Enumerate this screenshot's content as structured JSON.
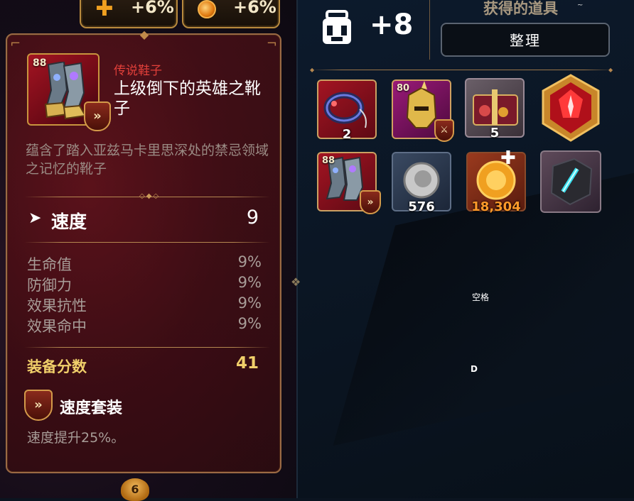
{
  "top_stats": [
    {
      "icon": "plus-icon",
      "value": "+6%"
    },
    {
      "icon": "coin-icon",
      "value": "+6%"
    }
  ],
  "tooltip": {
    "item_level": "88",
    "rarity": "传说鞋子",
    "name": "上级倒下的英雄之靴子",
    "description": "蕴含了踏入亚兹马卡里思深处的禁忌领域之记忆的靴子",
    "main_stat": {
      "label": "速度",
      "value": "9",
      "icon": "chevron-icon"
    },
    "sub_stats": [
      {
        "label": "生命值",
        "value": "9%"
      },
      {
        "label": "防御力",
        "value": "9%"
      },
      {
        "label": "效果抗性",
        "value": "9%"
      },
      {
        "label": "效果命中",
        "value": "9%"
      }
    ],
    "score": {
      "label": "装备分数",
      "value": "41"
    },
    "set": {
      "name": "速度套装",
      "description": "速度提升25%。"
    }
  },
  "bottom_badge": "6",
  "inventory": {
    "bag_count": "+8",
    "header_title": "获得的道具",
    "header_sub": "~",
    "sort_button": "整理",
    "items": [
      {
        "name": "ring-item",
        "rarity": "red",
        "qty": "2"
      },
      {
        "name": "helmet-item",
        "rarity": "purple",
        "level": "80"
      },
      {
        "name": "gift-box-item",
        "rarity": "gray",
        "qty": "5"
      },
      {
        "name": "red-gem-item",
        "rarity": "red-gem"
      },
      {
        "name": "boots-item",
        "rarity": "red",
        "level": "88"
      },
      {
        "name": "silver-coin-item",
        "rarity": "blue",
        "qty": "576"
      },
      {
        "name": "gold-coin-item",
        "rarity": "orange",
        "qty": "18,304"
      },
      {
        "name": "blue-stone-item",
        "rarity": "dark"
      }
    ]
  },
  "overlay_labels": {
    "space": "空格",
    "d": "D"
  },
  "colors": {
    "rarity_legend": "#e2403a",
    "score": "#f0cf6a",
    "frame_gold": "#c8953e"
  }
}
